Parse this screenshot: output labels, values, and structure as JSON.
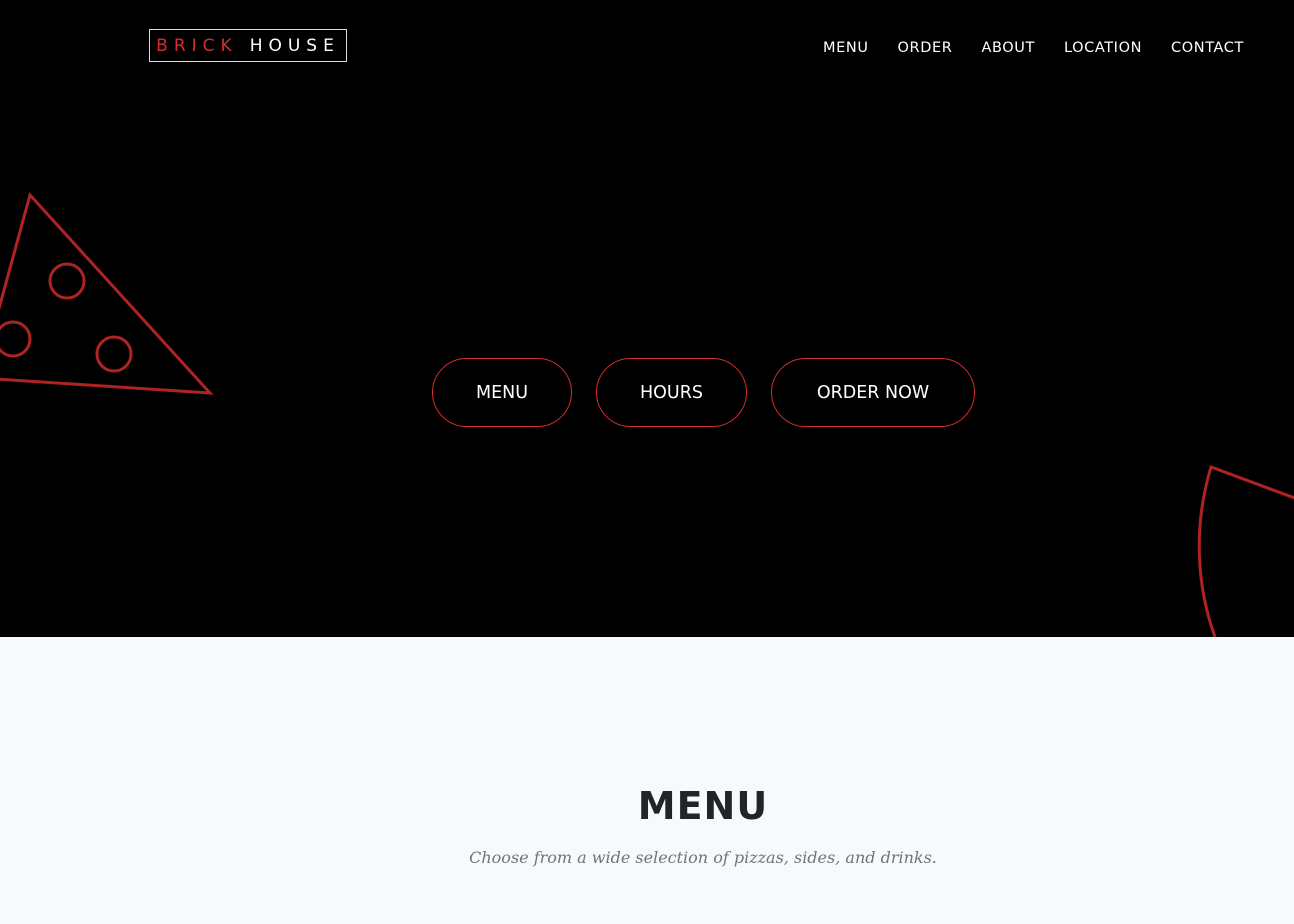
{
  "brand": {
    "part1": "BRICK",
    "part2": "HOUSE",
    "accent_color": "#d32f2f"
  },
  "nav": {
    "items": [
      "MENU",
      "ORDER",
      "ABOUT",
      "LOCATION",
      "CONTACT"
    ]
  },
  "hero": {
    "background": "#000000",
    "buttons": [
      "MENU",
      "HOURS",
      "ORDER NOW"
    ]
  },
  "menu_section": {
    "title": "MENU",
    "subtitle": "Choose from a wide selection of pizzas, sides, and drinks."
  }
}
